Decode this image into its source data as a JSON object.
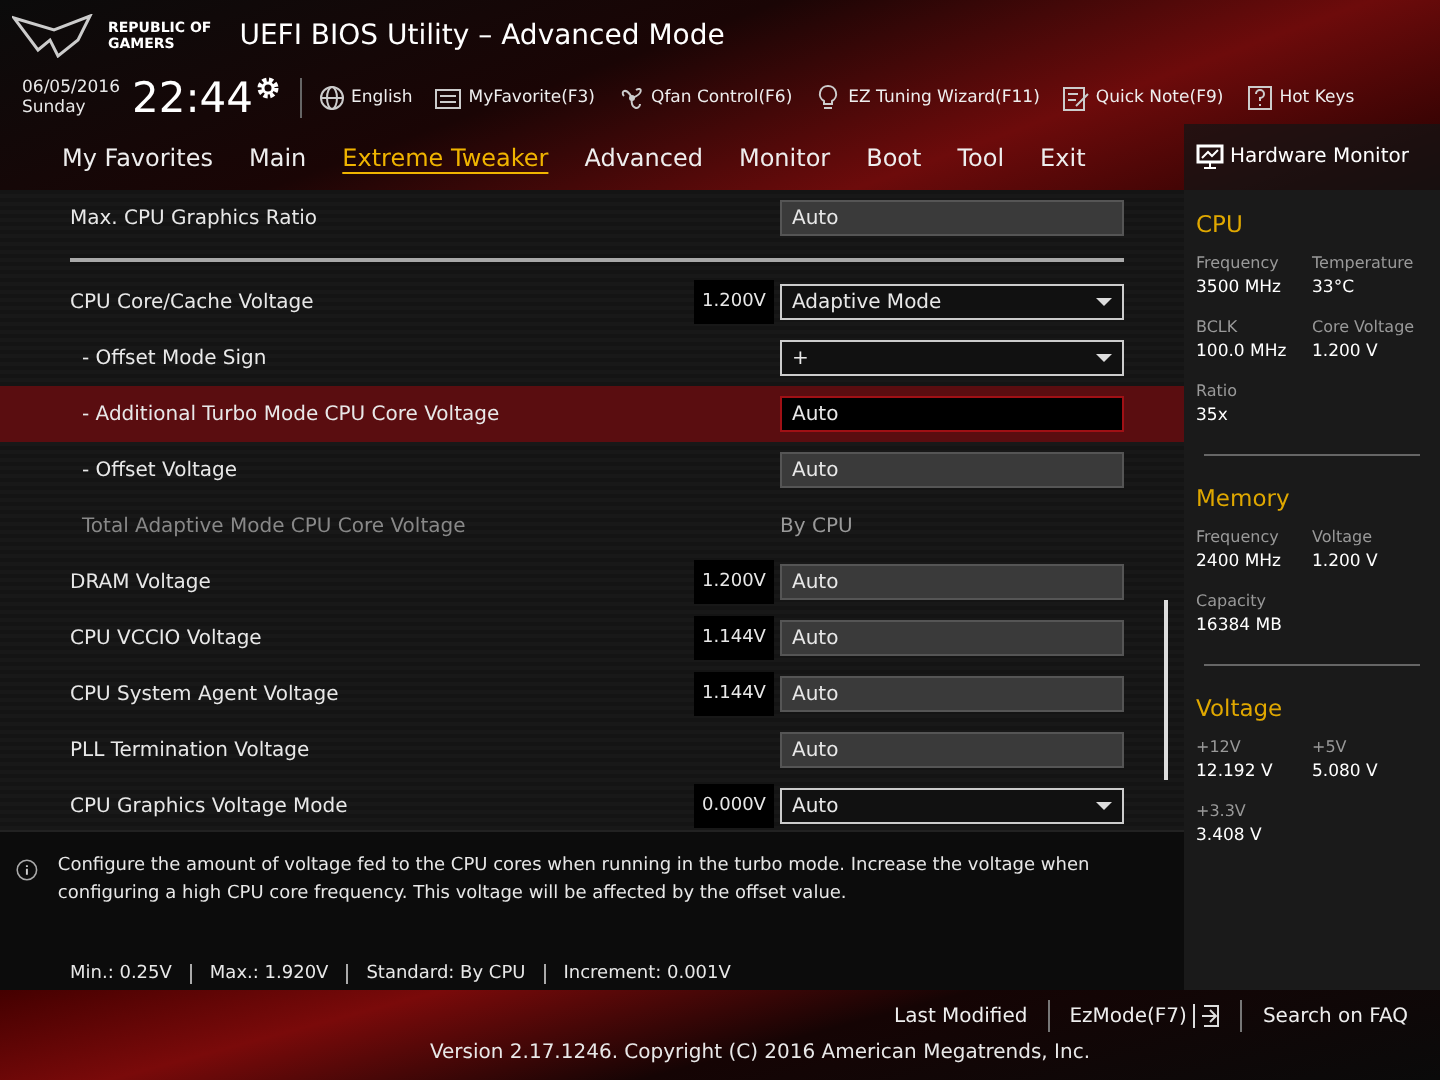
{
  "header": {
    "logo": [
      "REPUBLIC OF",
      "GAMERS"
    ],
    "title": "UEFI BIOS Utility – Advanced Mode"
  },
  "toolbar": {
    "date": "06/05/2016",
    "day": "Sunday",
    "time": "22:44",
    "items": [
      "English",
      "MyFavorite(F3)",
      "Qfan Control(F6)",
      "EZ Tuning Wizard(F11)",
      "Quick Note(F9)",
      "Hot Keys"
    ]
  },
  "tabs": [
    {
      "label": "My Favorites",
      "selected": false
    },
    {
      "label": "Main",
      "selected": false
    },
    {
      "label": "Extreme Tweaker",
      "selected": true
    },
    {
      "label": "Advanced",
      "selected": false
    },
    {
      "label": "Monitor",
      "selected": false
    },
    {
      "label": "Boot",
      "selected": false
    },
    {
      "label": "Tool",
      "selected": false
    },
    {
      "label": "Exit",
      "selected": false
    }
  ],
  "settings": [
    {
      "kind": "field",
      "label": "Max. CPU Graphics Ratio",
      "value": "Auto",
      "selected": false
    },
    {
      "kind": "divider"
    },
    {
      "kind": "dropdown",
      "label": "CPU Core/Cache Voltage",
      "reading": "1.200V",
      "value": "Adaptive Mode",
      "selected": false,
      "children": [
        {
          "kind": "dropdown",
          "label": "- Offset Mode Sign",
          "value": "+",
          "selected": false
        },
        {
          "kind": "field",
          "label": "- Additional Turbo Mode CPU Core Voltage",
          "value": "Auto",
          "selected": true
        },
        {
          "kind": "field",
          "label": "- Offset Voltage",
          "value": "Auto",
          "selected": false
        },
        {
          "kind": "readonly",
          "label": "Total Adaptive Mode CPU Core Voltage",
          "value": "By CPU",
          "selected": false
        }
      ]
    },
    {
      "kind": "field",
      "label": "DRAM Voltage",
      "reading": "1.200V",
      "value": "Auto",
      "selected": false
    },
    {
      "kind": "field",
      "label": "CPU VCCIO Voltage",
      "reading": "1.144V",
      "value": "Auto",
      "selected": false
    },
    {
      "kind": "field",
      "label": "CPU System Agent Voltage",
      "reading": "1.144V",
      "value": "Auto",
      "selected": false
    },
    {
      "kind": "field",
      "label": "PLL Termination Voltage",
      "value": "Auto",
      "selected": false
    },
    {
      "kind": "dropdown",
      "label": "CPU Graphics Voltage Mode",
      "reading": "0.000V",
      "value": "Auto",
      "selected": false
    }
  ],
  "help": {
    "text": "Configure the amount of voltage fed to the CPU cores when running in the turbo mode. Increase the voltage when configuring a high CPU core frequency. This voltage will be affected by the offset value.",
    "specs": [
      "Min.: 0.25V",
      "Max.: 1.920V",
      "Standard: By CPU",
      "Increment: 0.001V"
    ]
  },
  "hardware_monitor": {
    "title": "Hardware Monitor",
    "sections": [
      {
        "title": "CPU",
        "items": [
          {
            "label": "Frequency",
            "value": "3500 MHz"
          },
          {
            "label": "Temperature",
            "value": "33°C"
          },
          {
            "label": "BCLK",
            "value": "100.0 MHz"
          },
          {
            "label": "Core Voltage",
            "value": "1.200 V"
          },
          {
            "label": "Ratio",
            "value": "35x"
          }
        ]
      },
      {
        "title": "Memory",
        "items": [
          {
            "label": "Frequency",
            "value": "2400 MHz"
          },
          {
            "label": "Voltage",
            "value": "1.200 V"
          },
          {
            "label": "Capacity",
            "value": "16384 MB"
          }
        ]
      },
      {
        "title": "Voltage",
        "items": [
          {
            "label": "+12V",
            "value": "12.192 V"
          },
          {
            "label": "+5V",
            "value": "5.080 V"
          },
          {
            "label": "+3.3V",
            "value": "3.408 V"
          }
        ]
      }
    ]
  },
  "footer": {
    "links": [
      "Last Modified",
      "EzMode(F7)",
      "Search on FAQ"
    ],
    "version": "Version 2.17.1246. Copyright (C) 2016 American Megatrends, Inc."
  }
}
